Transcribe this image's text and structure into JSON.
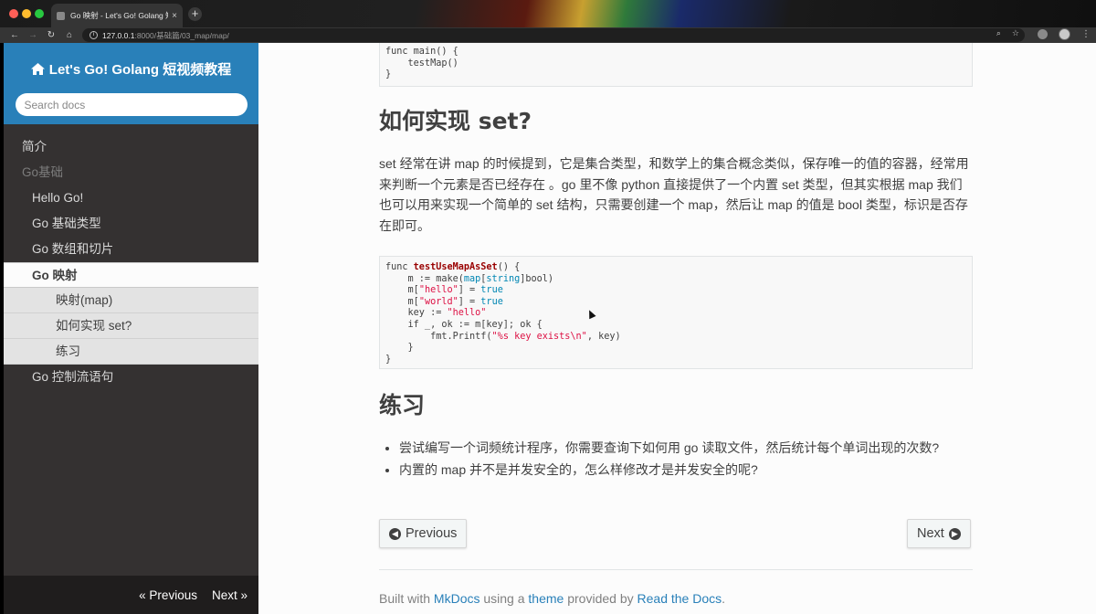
{
  "browser": {
    "tab_title": "Go 映射 - Let's Go! Golang 短视频教程",
    "tab_close": "×",
    "new_tab": "+",
    "url_host": "127.0.0.1",
    "url_rest": ":8000/基础篇/03_map/map/",
    "nav": {
      "back": "←",
      "forward": "→",
      "reload": "↻",
      "home": "⌂"
    }
  },
  "sidebar": {
    "site_title": "Let's Go! Golang 短视频教程",
    "search_placeholder": "Search docs",
    "items": [
      {
        "label": "简介"
      },
      {
        "label": "Go基础"
      },
      {
        "label": "Hello Go!"
      },
      {
        "label": "Go 基础类型"
      },
      {
        "label": "Go 数组和切片"
      },
      {
        "label": "Go 映射"
      },
      {
        "label": "映射(map)"
      },
      {
        "label": "如何实现 set?"
      },
      {
        "label": "练习"
      },
      {
        "label": "Go 控制流语句"
      }
    ],
    "footer_prev": "« Previous",
    "footer_next": "Next »"
  },
  "content": {
    "code1": [
      "func main() {",
      "    testMap()",
      "}"
    ],
    "heading_set": "如何实现 set?",
    "para_set": "set 经常在讲 map 的时候提到，它是集合类型，和数学上的集合概念类似，保存唯一的值的容器，经常用来判断一个元素是否已经存在 。go 里不像 python 直接提供了一个内置 set 类型，但其实根据 map 我们也可以用来实现一个简单的 set 结构，只需要创建一个 map，然后让 map 的值是 bool 类型，标识是否存在即可。",
    "code2": {
      "l1_func": "func ",
      "l1_name": "testUseMapAsSet",
      "l1_tail": "() {",
      "l2_a": "    m := make(",
      "l2_map": "map",
      "l2_b": "[",
      "l2_string": "string",
      "l2_c": "]bool)",
      "l3_a": "    m[",
      "l3_str": "\"hello\"",
      "l3_b": "] = ",
      "l3_true": "true",
      "l4_a": "    m[",
      "l4_str": "\"world\"",
      "l4_b": "] = ",
      "l4_true": "true",
      "l5_a": "    key := ",
      "l5_str": "\"hello\"",
      "l6": "    if _, ok := m[key]; ok {",
      "l7_a": "        fmt.Printf(",
      "l7_str": "\"%s key exists\\n\"",
      "l7_b": ", key)",
      "l8": "    }",
      "l9": "}"
    },
    "heading_ex": "练习",
    "exercises": [
      "尝试编写一个词频统计程序，你需要查询下如何用 go 读取文件，然后统计每个单词出现的次数?",
      "内置的 map 并不是并发安全的，怎么样修改才是并发安全的呢?"
    ],
    "btn_prev": "Previous",
    "btn_next": "Next",
    "footer": {
      "built_with": "Built with ",
      "mkdocs": "MkDocs",
      "using": " using a ",
      "theme": "theme",
      "provided": " provided by ",
      "rtd": "Read the Docs",
      "dot": "."
    }
  },
  "colors": {
    "accent": "#2980b9",
    "sidebar_bg": "#343131",
    "content_bg": "#fcfcfc"
  }
}
